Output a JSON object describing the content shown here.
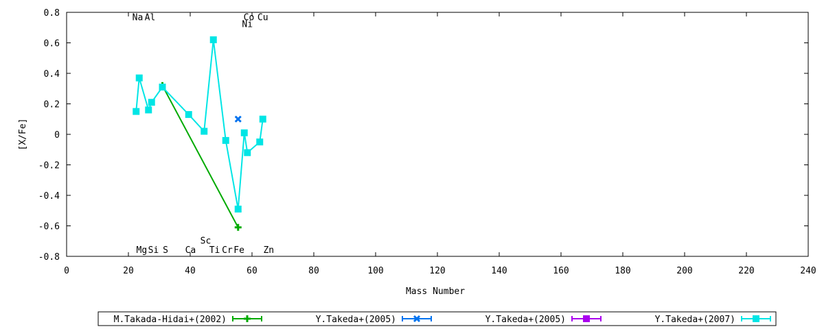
{
  "chart_data": {
    "type": "scatter",
    "xlabel": "Mass Number",
    "ylabel": "[X/Fe]",
    "xlim": [
      0,
      240
    ],
    "ylim": [
      -0.8,
      0.8
    ],
    "xticks": [
      "0",
      "20",
      "40",
      "60",
      "80",
      "100",
      "120",
      "140",
      "160",
      "180",
      "200",
      "220",
      "240"
    ],
    "yticks": [
      "0.8",
      "0.6",
      "0.4",
      "0.2",
      "0",
      "-0.2",
      "-0.4",
      "-0.6",
      "-0.8"
    ],
    "grid": false,
    "legend_position": "bottom",
    "element_labels": [
      {
        "text": "Na",
        "x": 23,
        "y": 0.77
      },
      {
        "text": "Al",
        "x": 27,
        "y": 0.77
      },
      {
        "text": "Co",
        "x": 59,
        "y": 0.77
      },
      {
        "text": "Cu",
        "x": 63.5,
        "y": 0.77
      },
      {
        "text": "Ni",
        "x": 58.5,
        "y": 0.725
      },
      {
        "text": "Mg",
        "x": 24.3,
        "y": -0.755
      },
      {
        "text": "Si",
        "x": 28.1,
        "y": -0.755
      },
      {
        "text": "S",
        "x": 32,
        "y": -0.755
      },
      {
        "text": "Ca",
        "x": 40.1,
        "y": -0.755
      },
      {
        "text": "Sc",
        "x": 45,
        "y": -0.695
      },
      {
        "text": "Ti",
        "x": 47.9,
        "y": -0.755
      },
      {
        "text": "Cr",
        "x": 52,
        "y": -0.755
      },
      {
        "text": "Fe",
        "x": 55.8,
        "y": -0.755
      },
      {
        "text": "Zn",
        "x": 65.4,
        "y": -0.755
      }
    ],
    "series": [
      {
        "name": "M.Takada-Hidai+(2002)",
        "color": "#00aa00",
        "marker": "plus",
        "line": true,
        "x": [
          31,
          55.5
        ],
        "y": [
          0.32,
          -0.61
        ]
      },
      {
        "name": "Y.Takeda+(2005)",
        "color": "#0072ef",
        "marker": "cross",
        "line": false,
        "x": [
          55.5
        ],
        "y": [
          0.1
        ]
      },
      {
        "name": "Y.Takeda+(2005)",
        "color": "#aa00ee",
        "marker": "square",
        "line": false,
        "x": [],
        "y": []
      },
      {
        "name": "Y.Takeda+(2007)",
        "color": "#00e5e5",
        "marker": "square",
        "line": true,
        "x": [
          22.5,
          23.5,
          26.5,
          27.5,
          31,
          39.5,
          44.5,
          47.5,
          51.5,
          55.5,
          57.5,
          58.5,
          62.5,
          63.5
        ],
        "y": [
          0.15,
          0.37,
          0.16,
          0.21,
          0.31,
          0.13,
          0.02,
          0.62,
          -0.04,
          -0.49,
          0.01,
          -0.12,
          -0.05,
          0.1
        ]
      }
    ]
  }
}
